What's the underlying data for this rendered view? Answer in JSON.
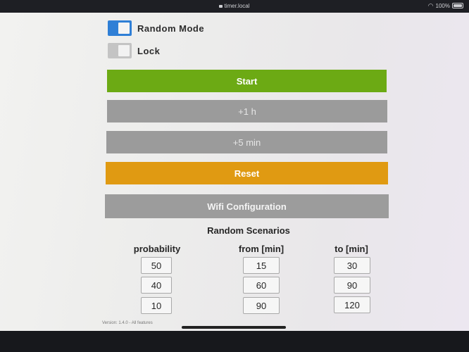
{
  "status_bar": {
    "url": "timer.local",
    "battery": "100%"
  },
  "toggles": {
    "random_mode": {
      "label": "Random Mode",
      "on": true
    },
    "lock": {
      "label": "Lock",
      "on": false
    }
  },
  "buttons": {
    "start": "Start",
    "plus_hour": "+1 h",
    "plus_five_min": "+5 min",
    "reset": "Reset",
    "wifi_config": "Wifi Configuration"
  },
  "scenarios": {
    "title": "Random Scenarios",
    "columns": [
      "probability",
      "from [min]",
      "to [min]"
    ],
    "rows": [
      {
        "probability": "50",
        "from": "15",
        "to": "30"
      },
      {
        "probability": "40",
        "from": "60",
        "to": "90"
      },
      {
        "probability": "10",
        "from": "90",
        "to": "120"
      }
    ]
  },
  "footer": {
    "version": "Version: 1.4.0 - All features"
  },
  "colors": {
    "start": "#6caa14",
    "reset": "#e09a12",
    "toggle_on": "#2f7fd6",
    "button_gray": "#9b9b9b"
  }
}
